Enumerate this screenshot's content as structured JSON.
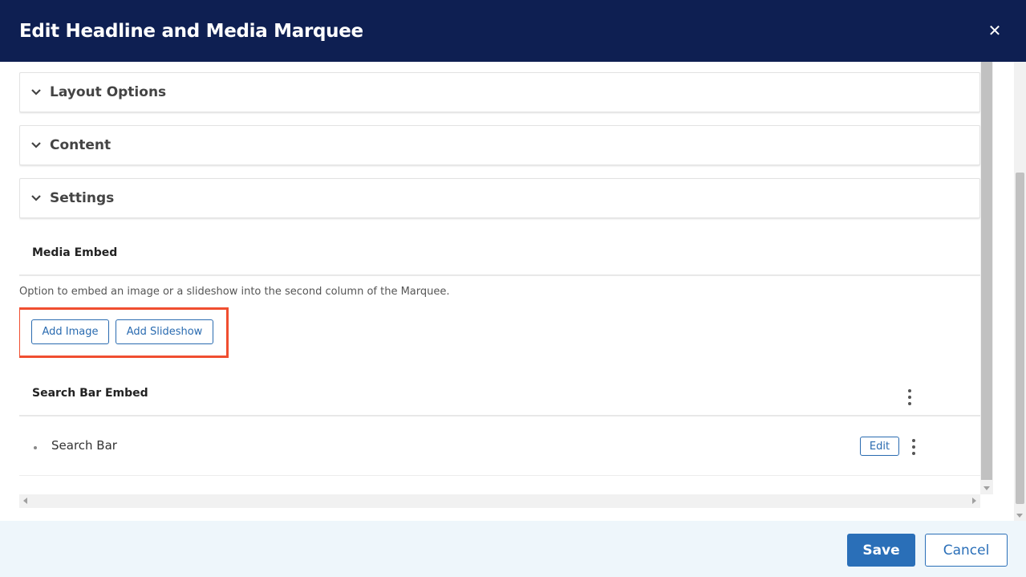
{
  "modal": {
    "title": "Edit Headline and Media Marquee",
    "close_icon": "close-icon"
  },
  "accordions": [
    {
      "label": "Layout Options",
      "icon": "chevron-down-icon"
    },
    {
      "label": "Content",
      "icon": "chevron-down-icon"
    },
    {
      "label": "Settings",
      "icon": "chevron-down-icon"
    }
  ],
  "media_embed": {
    "title": "Media Embed",
    "help_text": "Option to embed an image or a slideshow into the second column of the Marquee.",
    "add_image_label": "Add Image",
    "add_slideshow_label": "Add Slideshow",
    "highlight_color": "#f04e30"
  },
  "search_bar_embed": {
    "title": "Search Bar Embed",
    "items": [
      {
        "label": "Search Bar",
        "edit_label": "Edit"
      }
    ]
  },
  "footer": {
    "save_label": "Save",
    "cancel_label": "Cancel"
  },
  "colors": {
    "header_bg": "#0e1f52",
    "primary": "#2a6fb8",
    "footer_bg": "#eef6fb"
  }
}
